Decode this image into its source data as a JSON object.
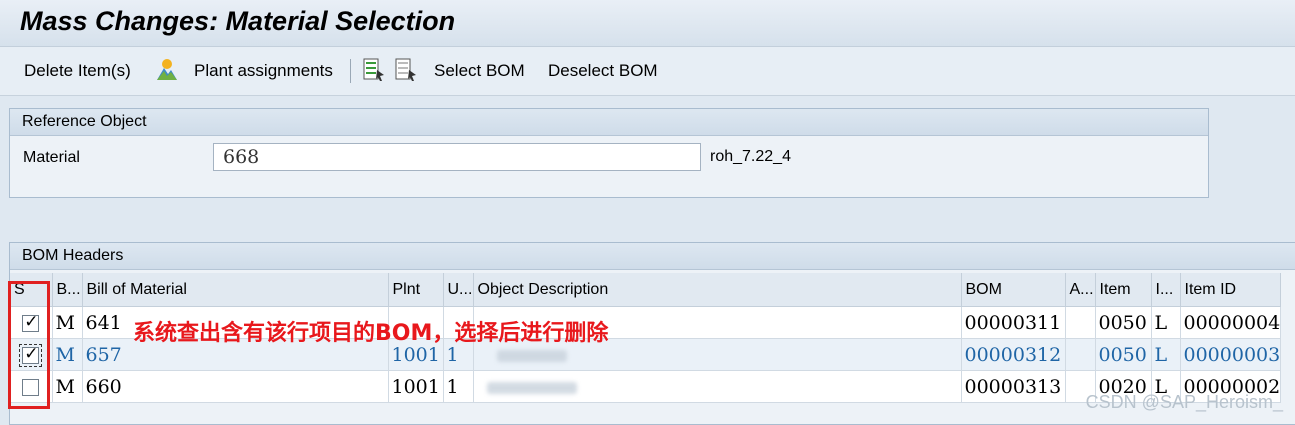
{
  "title": "Mass Changes: Material Selection",
  "toolbar": {
    "delete_label": "Delete Item(s)",
    "plant_label": "Plant assignments",
    "select_bom_label": "Select BOM",
    "deselect_bom_label": "Deselect BOM"
  },
  "reference": {
    "group_title": "Reference Object",
    "material_label": "Material",
    "material_value": "668",
    "material_desc": "roh_7.22_4"
  },
  "bom_headers": {
    "group_title": "BOM Headers",
    "columns": [
      "S",
      "B...",
      "Bill of Material",
      "Plnt",
      "U...",
      "Object Description",
      "BOM",
      "A...",
      "Item",
      "I...",
      "Item ID"
    ],
    "rows": [
      {
        "checked": true,
        "b": "M",
        "bill": "641",
        "plnt": "",
        "u": "",
        "desc": "",
        "bom": "00000311",
        "a": "",
        "item": "0050",
        "i": "L",
        "item_id": "00000004"
      },
      {
        "checked": true,
        "b": "M",
        "bill": "657",
        "plnt": "1001",
        "u": "1",
        "desc": "",
        "bom": "00000312",
        "a": "",
        "item": "0050",
        "i": "L",
        "item_id": "00000003"
      },
      {
        "checked": false,
        "b": "M",
        "bill": "660",
        "plnt": "1001",
        "u": "1",
        "desc": "",
        "bom": "00000313",
        "a": "",
        "item": "0020",
        "i": "L",
        "item_id": "00000002"
      }
    ]
  },
  "annotation": "系统查出含有该行项目的BOM，选择后进行删除",
  "watermark": "CSDN @SAP_Heroism_"
}
